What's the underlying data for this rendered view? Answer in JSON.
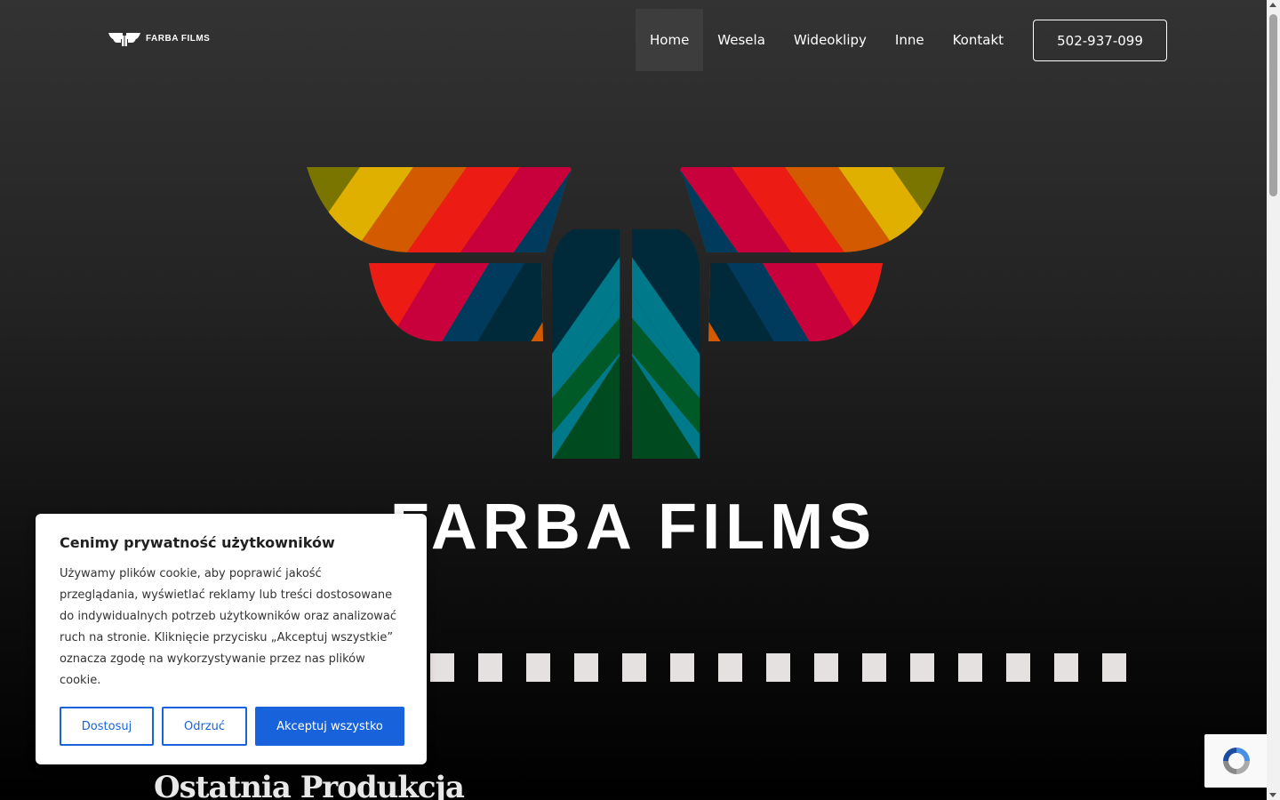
{
  "header": {
    "logo_text": "FARBA FILMS",
    "nav": [
      {
        "label": "Home",
        "active": true
      },
      {
        "label": "Wesela",
        "active": false
      },
      {
        "label": "Wideoklipy",
        "active": false
      },
      {
        "label": "Inne",
        "active": false
      },
      {
        "label": "Kontakt",
        "active": false
      }
    ],
    "phone": "502-937-099"
  },
  "hero": {
    "title": "FARBA FILMS",
    "film_holes": 16
  },
  "section": {
    "heading": "Ostatnia Produkcja"
  },
  "cookie": {
    "title": "Cenimy prywatność użytkowników",
    "text": "Używamy plików cookie, aby poprawić jakość przeglądania, wyświetlać reklamy lub treści dostosowane do indywidualnych potrzeb użytkowników oraz analizować ruch na stronie. Kliknięcie przycisku „Akceptuj wszystkie” oznacza zgodę na wykorzystywanie przez nas plików cookie.",
    "buttons": {
      "customize": "Dostosuj",
      "reject": "Odrzuć",
      "accept": "Akceptuj wszystko"
    }
  },
  "colors": {
    "accent": "#1863dc",
    "nav_active_bg": "#3d3d3d",
    "film_hole": "#e6e1e1"
  },
  "icons": {
    "logo": "farba-butterfly-logo-icon",
    "recaptcha": "recaptcha-icon"
  }
}
